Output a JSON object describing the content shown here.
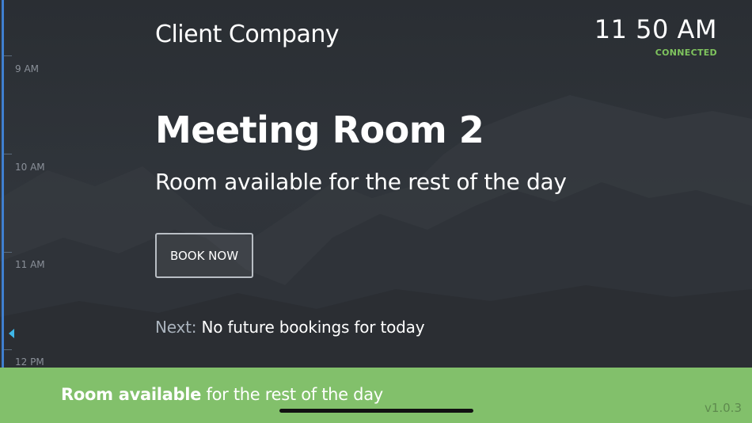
{
  "header": {
    "company": "Client Company",
    "time": "11 50 AM",
    "connection_status": "CONNECTED"
  },
  "timeline": {
    "labels": [
      "9 AM",
      "10 AM",
      "11 AM",
      "12 PM"
    ]
  },
  "room": {
    "name": "Meeting Room 2",
    "status": "Room available for the rest of the day",
    "book_label": "BOOK NOW",
    "next_label": "Next:",
    "next_value": "No future bookings for today"
  },
  "footer": {
    "status_bold": "Room available",
    "status_rest": "for the rest of the day",
    "version": "v1.0.3"
  },
  "colors": {
    "available_green": "#82c06b",
    "connected_green": "#7fc45e",
    "timeline_blue": "#3f7fd0",
    "now_marker": "#3fb7e8"
  }
}
